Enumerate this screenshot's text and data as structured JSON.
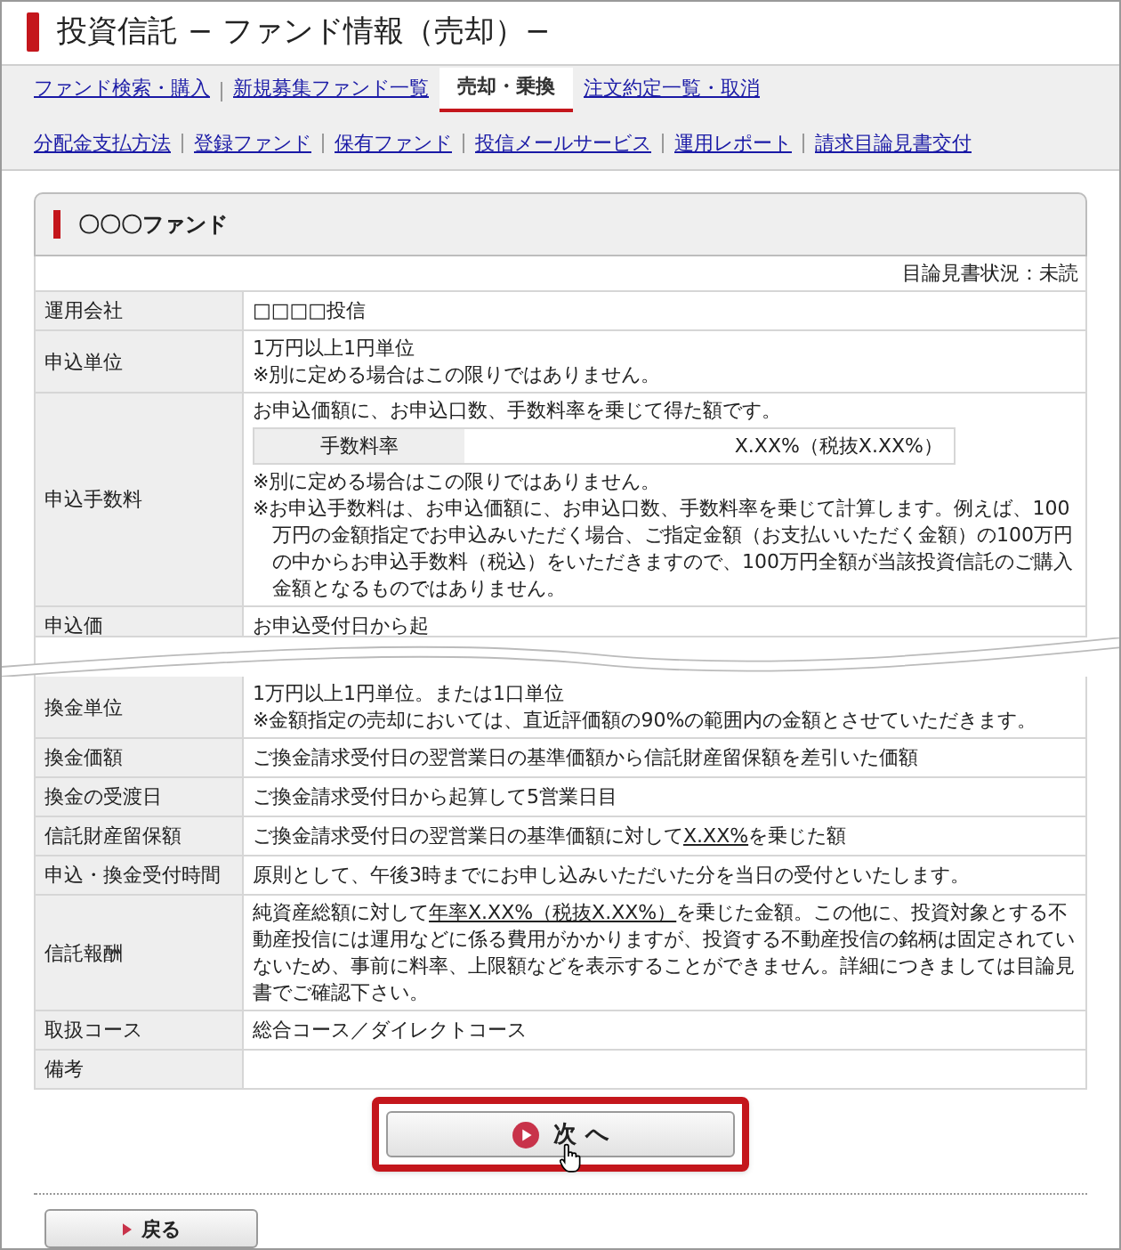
{
  "title": "投資信託 − ファンド情報（売却）−",
  "nav_tabs": [
    {
      "label": "ファンド検索・購入",
      "selected": false
    },
    {
      "label": "新規募集ファンド一覧",
      "selected": false
    },
    {
      "label": "売却・乗換",
      "selected": true
    },
    {
      "label": "注文約定一覧・取消",
      "selected": false
    }
  ],
  "sub_links": [
    "分配金支払方法",
    "登録ファンド",
    "保有ファンド",
    "投信メールサービス",
    "運用レポート",
    "請求目論見書交付"
  ],
  "fund_name": "〇〇〇ファンド",
  "prospectus_status": "目論見書状況：未読",
  "rows": [
    {
      "kind": "text",
      "label": "運用会社",
      "lines": [
        "□□□□投信"
      ]
    },
    {
      "kind": "text",
      "label": "申込単位",
      "lines": [
        "1万円以上1円単位",
        "※別に定める場合はこの限りではありません。"
      ]
    },
    {
      "kind": "fee",
      "label": "申込手数料",
      "intro": "お申込価額に、お申込口数、手数料率を乗じて得た額です。",
      "fee_label": "手数料率",
      "fee_value": "X.XX%（税抜X.XX%）",
      "notes": [
        "※別に定める場合はこの限りではありません。",
        "※お申込手数料は、お申込価額に、お申込口数、手数料率を乗じて計算します。例えば、100万円の金額指定でお申込みいただく場合、ご指定金額（お支払いいただく金額）の100万円の中からお申込手数料（税込）をいただきますので、100万円全額が当該投資信託のご購入金額となるものではありません。"
      ]
    },
    {
      "kind": "cut",
      "label": "申込価",
      "lines": [
        "お申込受付日から起"
      ]
    },
    {
      "kind": "text",
      "label": "換金単位",
      "lines": [
        "1万円以上1円単位。または1口単位",
        "※金額指定の売却においては、直近評価額の90%の範囲内の金額とさせていただきます。"
      ]
    },
    {
      "kind": "text",
      "label": "換金価額",
      "lines": [
        "ご換金請求受付日の翌営業日の基準価額から信託財産留保額を差引いた価額"
      ]
    },
    {
      "kind": "text",
      "label": "換金の受渡日",
      "lines": [
        "ご換金請求受付日から起算して5営業日目"
      ]
    },
    {
      "kind": "parts",
      "label": "信託財産留保額",
      "parts": [
        {
          "kind": "text",
          "text": "ご換金請求受付日の翌営業日の基準価額に対して"
        },
        {
          "kind": "link",
          "text": "X.XX%"
        },
        {
          "kind": "text",
          "text": "を乗じた額"
        }
      ]
    },
    {
      "kind": "text",
      "label": "申込・換金受付時間",
      "lines": [
        "原則として、午後3時までにお申し込みいただいた分を当日の受付といたします。"
      ]
    },
    {
      "kind": "parts",
      "label": "信託報酬",
      "parts": [
        {
          "kind": "text",
          "text": "純資産総額に対して"
        },
        {
          "kind": "link",
          "text": "年率X.XX%（税抜X.XX%）"
        },
        {
          "kind": "text",
          "text": "を乗じた金額。この他に、投資対象とする不動産投信には運用などに係る費用がかかりますが、投資する不動産投信の銘柄は固定されていないため、事前に料率、上限額などを表示することができません。詳細につきましては目論見書でご確認下さい。"
        }
      ]
    },
    {
      "kind": "text",
      "label": "取扱コース",
      "lines": [
        "総合コース／ダイレクトコース"
      ]
    },
    {
      "kind": "text",
      "label": "備考",
      "lines": []
    }
  ],
  "next_button": "次 へ",
  "back_button": "戻る"
}
